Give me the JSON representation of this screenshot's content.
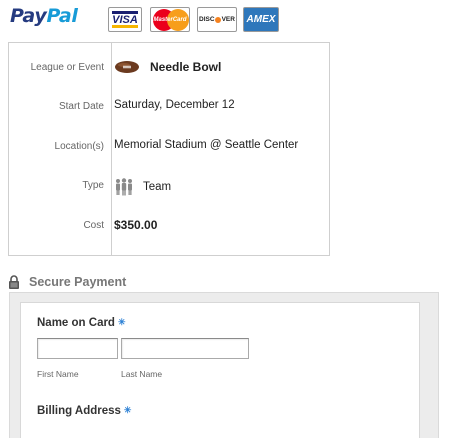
{
  "header": {
    "paypal_logo_part1": "Pay",
    "paypal_logo_part2": "Pal",
    "cards": {
      "visa": "VISA",
      "mastercard": "MasterCard",
      "discover_part1": "DISC",
      "discover_part2": "VER",
      "amex": "AMEX"
    }
  },
  "event": {
    "league_label": "League or Event",
    "league_value": "Needle Bowl",
    "league_icon": "football-icon",
    "start_label": "Start Date",
    "start_value": "Saturday, December 12",
    "location_label": "Location(s)",
    "location_value": "Memorial Stadium @ Seattle Center",
    "type_label": "Type",
    "type_value": "Team",
    "type_icon": "team-icon",
    "cost_label": "Cost",
    "cost_value": "$350.00"
  },
  "payment": {
    "section_title": "Secure Payment",
    "section_icon": "lock-icon",
    "name_title": "Name on Card",
    "required_mark": "✳",
    "first_name_label": "First Name",
    "last_name_label": "Last Name",
    "first_name_value": "",
    "last_name_value": "",
    "billing_title": "Billing Address"
  },
  "colors": {
    "paypal_dark": "#253b80",
    "paypal_light": "#179bd7",
    "required": "#2a7fd4",
    "panel_bg": "#ececec"
  }
}
